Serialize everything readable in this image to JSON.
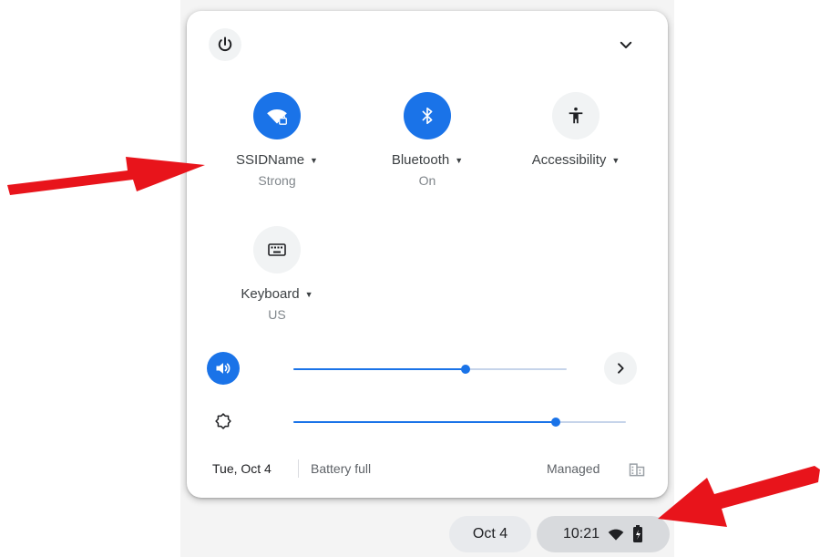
{
  "header": {
    "power_icon": "power-icon",
    "collapse_icon": "chevron-down-icon"
  },
  "tiles": [
    {
      "label": "SSIDName",
      "sublabel": "Strong",
      "icon": "wifi-lock-icon",
      "active": true
    },
    {
      "label": "Bluetooth",
      "sublabel": "On",
      "icon": "bluetooth-icon",
      "active": true
    },
    {
      "label": "Accessibility",
      "sublabel": "",
      "icon": "accessibility-icon",
      "active": false
    },
    {
      "label": "Keyboard",
      "sublabel": "US",
      "icon": "keyboard-icon",
      "active": false
    }
  ],
  "sliders": {
    "volume": {
      "value": 0.63,
      "icon": "volume-icon"
    },
    "brightness": {
      "value": 0.79,
      "icon": "brightness-icon"
    }
  },
  "footer": {
    "date": "Tue, Oct 4",
    "battery": "Battery full",
    "managed": "Managed"
  },
  "shelf": {
    "date": "Oct 4",
    "time": "10:21"
  },
  "colors": {
    "accent": "#1a73e8",
    "annotation": "#e8141b"
  }
}
